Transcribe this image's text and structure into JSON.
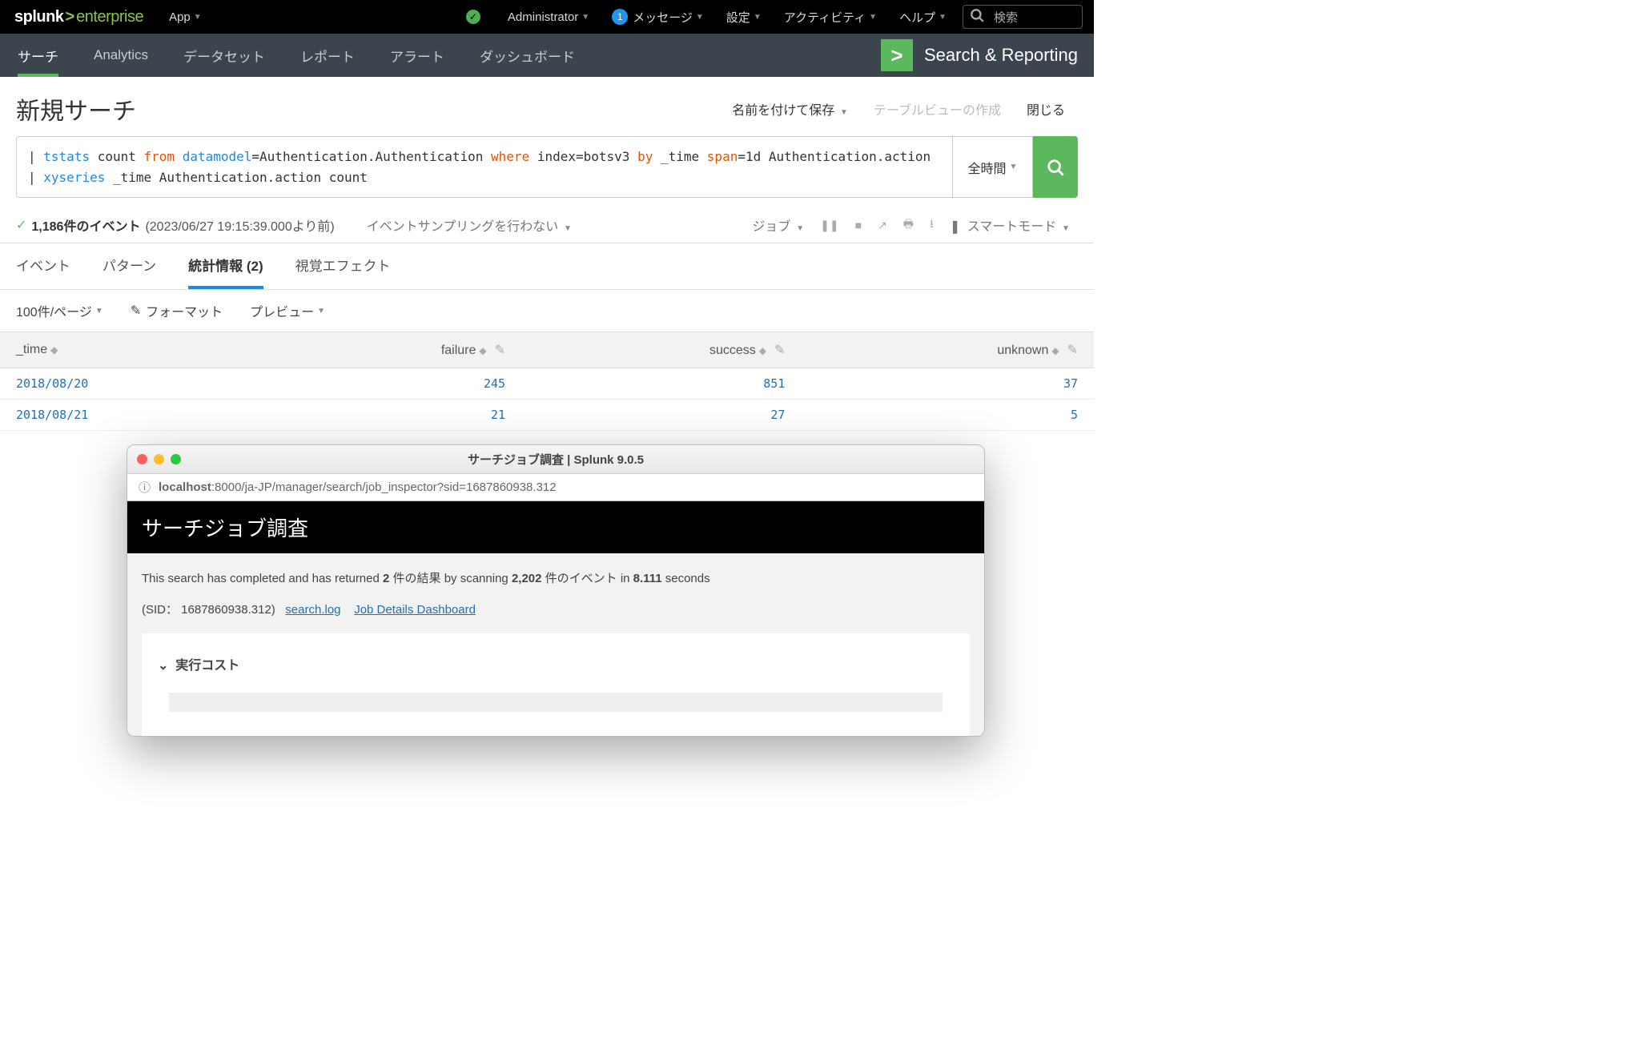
{
  "topbar": {
    "brand1": "splunk",
    "brand2": "enterprise",
    "app_label": "App",
    "admin_label": "Administrator",
    "msg_count": "1",
    "msg_label": "メッセージ",
    "settings_label": "設定",
    "activity_label": "アクティビティ",
    "help_label": "ヘルプ",
    "search_placeholder": "検索"
  },
  "appbar": {
    "tabs": [
      "サーチ",
      "Analytics",
      "データセット",
      "レポート",
      "アラート",
      "ダッシュボード"
    ],
    "app_title": "Search & Reporting"
  },
  "pagehdr": {
    "title": "新規サーチ",
    "save_as": "名前を付けて保存",
    "create_table": "テーブルビューの作成",
    "close": "閉じる"
  },
  "search": {
    "spl_line1_parts": {
      "pipe": "|",
      "cmd": "tstats",
      "count": "count",
      "from": "from",
      "datamodel": "datamodel",
      "dm_val": "=Authentication.Authentication",
      "where": "where",
      "where_val": "index=botsv3",
      "by": "by",
      "by_field": "_time",
      "span": "span",
      "span_val": "=1d Authentication.action"
    },
    "spl_line2_parts": {
      "pipe": "|",
      "cmd": "xyseries",
      "rest": "_time Authentication.action count"
    },
    "time_label": "全時間"
  },
  "status": {
    "count_text": "1,186件のイベント",
    "time_text": "(2023/06/27 19:15:39.000より前)",
    "sampling": "イベントサンプリングを行わない",
    "job_label": "ジョブ",
    "mode_label": "スマートモード"
  },
  "restabs": {
    "events": "イベント",
    "patterns": "パターン",
    "stats": "統計情報 (2)",
    "viz": "視覚エフェクト"
  },
  "tblctrls": {
    "perpage": "100件/ページ",
    "format": "フォーマット",
    "preview": "プレビュー"
  },
  "table": {
    "headers": [
      "_time",
      "failure",
      "success",
      "unknown"
    ],
    "rows": [
      {
        "time": "2018/08/20",
        "failure": "245",
        "success": "851",
        "unknown": "37"
      },
      {
        "time": "2018/08/21",
        "failure": "21",
        "success": "27",
        "unknown": "5"
      }
    ]
  },
  "modal": {
    "title": "サーチジョブ調査 | Splunk 9.0.5",
    "url_host": "localhost",
    "url_rest": ":8000/ja-JP/manager/search/job_inspector?sid=1687860938.312",
    "section_title": "サーチジョブ調査",
    "summary_pre": "This search has completed and has returned",
    "summary_n1": "2",
    "summary_mid1": "件の結果 by scanning",
    "summary_n2": "2,202",
    "summary_mid2": "件のイベント  in",
    "summary_n3": "8.111",
    "summary_post": "seconds",
    "sid_label": "(SID：  1687860938.312)",
    "link1": "search.log",
    "link2": "Job Details Dashboard",
    "expander": "実行コスト"
  }
}
